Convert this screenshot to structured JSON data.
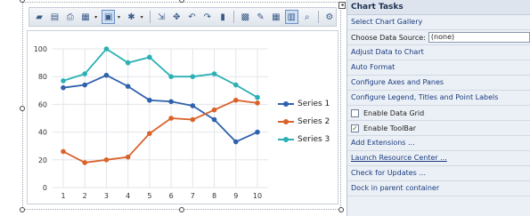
{
  "toolbar": {
    "icons": [
      "new-icon",
      "open-icon",
      "print-icon",
      "chart-type-icon",
      "palette-icon",
      "style-icon",
      "data-icon",
      "move-icon",
      "rotate-left-icon",
      "rotate-right-icon",
      "3d-icon",
      "gallery-icon",
      "wizard-icon",
      "grid-icon",
      "data-grid-icon",
      "zoom-icon",
      "properties-icon"
    ]
  },
  "chart_data": {
    "type": "line",
    "x": [
      1,
      2,
      3,
      4,
      5,
      6,
      7,
      8,
      9,
      10
    ],
    "ylim": [
      0,
      100
    ],
    "yticks": [
      0,
      20,
      40,
      60,
      80,
      100
    ],
    "xticks": [
      "1",
      "2",
      "3",
      "4",
      "5",
      "6",
      "7",
      "8",
      "9",
      "10"
    ],
    "title": "",
    "xlabel": "",
    "ylabel": "",
    "grid": true,
    "legend_position": "right",
    "series": [
      {
        "name": "Series 1",
        "color": "#2f62ad",
        "values": [
          72,
          74,
          81,
          73,
          63,
          62,
          59,
          49,
          33,
          40
        ]
      },
      {
        "name": "Series 2",
        "color": "#d9622b",
        "values": [
          26,
          18,
          20,
          22,
          39,
          50,
          49,
          56,
          63,
          61
        ]
      },
      {
        "name": "Series 3",
        "color": "#2ab0b5",
        "values": [
          77,
          82,
          100,
          90,
          94,
          80,
          80,
          82,
          74,
          65
        ]
      }
    ]
  },
  "tasks": {
    "header": "Chart Tasks",
    "select_gallery": "Select Chart Gallery",
    "choose_data_source_label": "Choose Data Source:",
    "choose_data_source_value": "(none)",
    "adjust_data": "Adjust Data to Chart",
    "auto_format": "Auto Format",
    "configure_axes": "Configure Axes and Panes",
    "configure_legend": "Configure Legend, Titles and Point Labels",
    "enable_data_grid": "Enable Data Grid",
    "enable_data_grid_checked": false,
    "enable_toolbar": "Enable ToolBar",
    "enable_toolbar_checked": true,
    "add_extensions": "Add Extensions ...",
    "launch_resource_center": "Launch Resource Center ...",
    "check_updates": "Check for Updates ...",
    "dock_parent": "Dock in parent container"
  }
}
